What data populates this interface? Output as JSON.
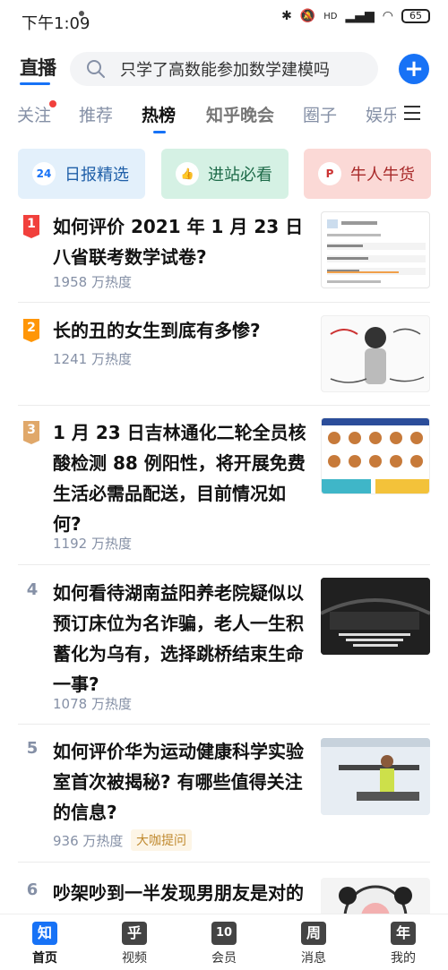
{
  "status_bar": {
    "time": "下午1:09",
    "bt": "✱",
    "mute": "🔕",
    "hd": "HD",
    "signal": "▂▄▆",
    "wifi": "◠",
    "battery": "65"
  },
  "header": {
    "live_label": "直播",
    "search_placeholder": "只学了高数能参加数学建模吗"
  },
  "tabs": [
    {
      "label": "关注"
    },
    {
      "label": "推荐"
    },
    {
      "label": "热榜"
    },
    {
      "label": "知乎晚会"
    },
    {
      "label": "圈子"
    },
    {
      "label": "娱乐"
    }
  ],
  "quick_links": [
    {
      "label": "日报精选",
      "icon": "24",
      "icon_name": "daily-icon"
    },
    {
      "label": "进站必看",
      "icon": "👍",
      "icon_name": "thumbs-up-icon"
    },
    {
      "label": "牛人牛货",
      "icon": "P",
      "icon_name": "flag-icon"
    }
  ],
  "hot_list": [
    {
      "rank": "1",
      "title": "如何评价 2021 年 1 月 23 日八省联考数学试卷?",
      "heat": "1958 万热度"
    },
    {
      "rank": "2",
      "title": "长的丑的女生到底有多惨?",
      "heat": "1241 万热度"
    },
    {
      "rank": "3",
      "title": "1 月 23 日吉林通化二轮全员核酸检测 88 例阳性，将开展免费生活必需品配送，目前情况如何?",
      "heat": "1192 万热度"
    },
    {
      "rank": "4",
      "title": "如何看待湖南益阳养老院疑似以预订床位为名诈骗，老人一生积蓄化为乌有，选择跳桥结束生命一事?",
      "heat": "1078 万热度"
    },
    {
      "rank": "5",
      "title": "如何评价华为运动健康科学实验室首次被揭秘? 有哪些值得关注的信息?",
      "heat": "936 万热度",
      "badge": "大咖提问"
    },
    {
      "rank": "6",
      "title": "吵架吵到一半发现男朋友是对的该怎么办?",
      "heat": ""
    }
  ],
  "bottom_nav": [
    {
      "label": "首页",
      "glyph": "知"
    },
    {
      "label": "视频",
      "glyph": "乎"
    },
    {
      "label": "会员",
      "glyph": "10"
    },
    {
      "label": "消息",
      "glyph": "周"
    },
    {
      "label": "我的",
      "glyph": "年"
    }
  ],
  "colors": {
    "accent": "#1772f6",
    "rank1": "#f1403c",
    "rank2": "#ff9607",
    "rank3": "#e0a86a"
  }
}
